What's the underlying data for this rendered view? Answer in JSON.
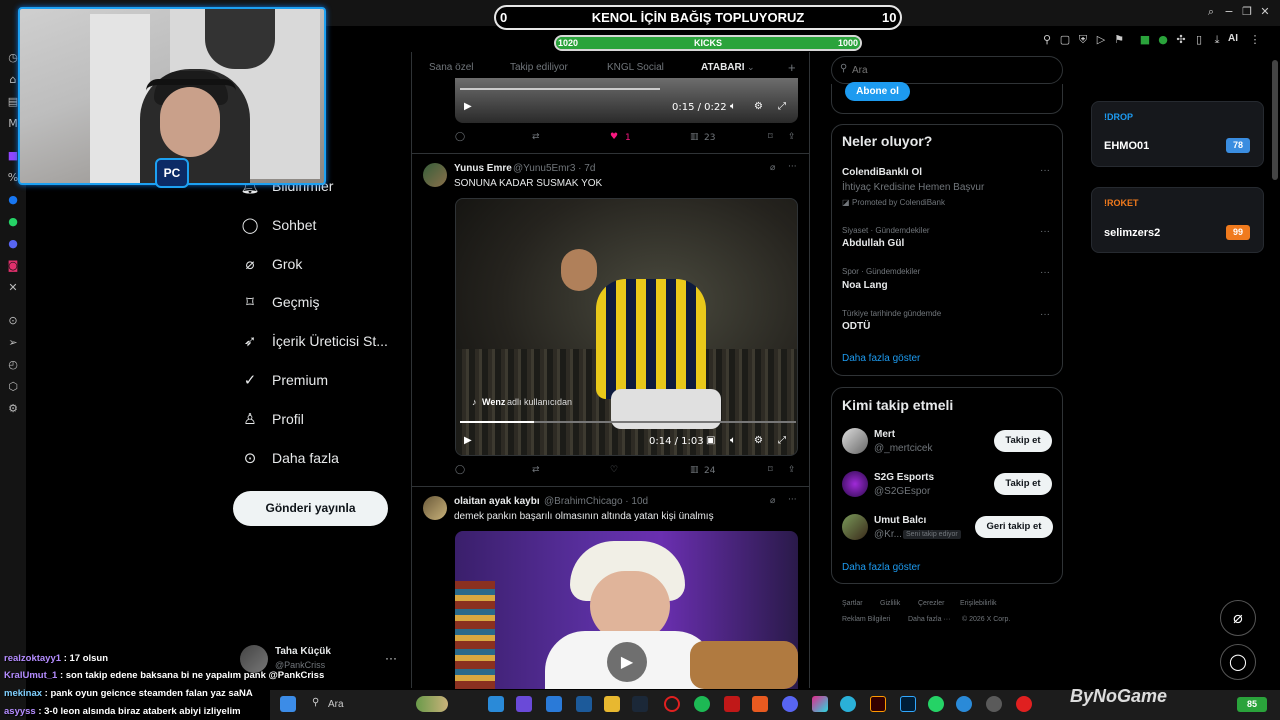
{
  "donation": {
    "left_count": "0",
    "title": "KENOL İÇİN BAĞIŞ TOPLUYORUZ",
    "right_count": "10",
    "kicks_left": "1020",
    "kicks_label": "KICKS",
    "kicks_right": "1000"
  },
  "browser": {
    "ai_label": "AI"
  },
  "nav": {
    "items": [
      {
        "label": "Bildirimler",
        "icon": "bell-icon"
      },
      {
        "label": "Sohbet",
        "icon": "chat-icon"
      },
      {
        "label": "Grok",
        "icon": "grok-icon"
      },
      {
        "label": "Geçmiş",
        "icon": "bookmark-icon"
      },
      {
        "label": "İçerik Üreticisi St...",
        "icon": "rocket-icon"
      },
      {
        "label": "Premium",
        "icon": "verified-icon"
      },
      {
        "label": "Profil",
        "icon": "person-icon"
      },
      {
        "label": "Daha fazla",
        "icon": "more-circle-icon"
      }
    ],
    "post_button": "Gönderi yayınla",
    "profile_name": "Taha Küçük",
    "profile_handle": "@PankCriss",
    "profile_more": "···"
  },
  "tabs": [
    "Sana özel",
    "Takip ediliyor",
    "KNGL Social",
    "ATABARI"
  ],
  "tab_plus": "+",
  "posts": [
    {
      "video_time": "0:15 / 0:22",
      "likes": "1",
      "views": "23"
    },
    {
      "name": "Yunus Emre",
      "handle": "@Yunu5Emr3 · 7d",
      "text": "SONUNA KADAR SUSMAK YOK",
      "video_credit_user": "Wenz",
      "video_credit_suffix": "adlı kullanıcıdan",
      "video_time": "0:14 / 1:03",
      "views": "24"
    },
    {
      "name": "olaitan ayak kaybı",
      "handle": "@BrahimChicago · 10d",
      "text": "demek pankın başarılı olmasının altında yatan kişi ünalmış"
    }
  ],
  "search": {
    "placeholder": "Ara"
  },
  "subscribe_button": "Abone ol",
  "trends": {
    "title": "Neler oluyor?",
    "items": [
      {
        "category": "",
        "title": "ColendiBankl⁠ı Ol",
        "sub": "İhtiyaç Kredisine Hemen Başvur",
        "promo": "Promoted by ColendiBank"
      },
      {
        "category": "Siyaset · Gündemdekiler",
        "title": "Abdullah Gül"
      },
      {
        "category": "Spor · Gündemdekiler",
        "title": "Noa Lang"
      },
      {
        "category": "Türkiye tarihinde gündemde",
        "title": "ODTÜ"
      }
    ],
    "more": "Daha fazla göster"
  },
  "who_to_follow": {
    "title": "Kimi takip etmeli",
    "items": [
      {
        "name": "Mert",
        "handle": "@_mertcicek",
        "button": "Takip et"
      },
      {
        "name": "S2G Esports",
        "handle": "@S2GEspor",
        "button": "Takip et"
      },
      {
        "name": "Umut Balcı",
        "handle": "@Kr...",
        "badge": "Seni takip ediyor",
        "button": "Geri takip et"
      }
    ],
    "more": "Daha fazla göster"
  },
  "footer": [
    "Şartlar",
    "Gizlilik",
    "Çerezler",
    "Erişilebilirlik",
    "Reklam Bilgileri",
    "Daha fazla ···",
    "© 2026 X Corp."
  ],
  "widgets": [
    {
      "title": "!DROP",
      "name": "EHMO01",
      "value": "78",
      "color": "#1d9bf0"
    },
    {
      "title": "!ROKET",
      "name": "selimzers2",
      "value": "99",
      "color": "#f07a1d"
    }
  ],
  "chat": [
    {
      "user": "realzoktayy1",
      "text": ": 17 olsun"
    },
    {
      "user": "KralUmut_1",
      "text": ": son takip edene baksana bi ne yapalım pank @PankCriss"
    },
    {
      "user": "mekinax",
      "text": ": pank oyun geicnce steamden falan yaz saNA"
    },
    {
      "user": "asyyss",
      "text": ": 3-0 leon alsında biraz ataberk abiyi izliyelim"
    }
  ],
  "taskbar": {
    "search_label": "Ara",
    "battery": "85"
  },
  "webcam": {
    "logo": "PC"
  },
  "watermark": "ByNoGame"
}
